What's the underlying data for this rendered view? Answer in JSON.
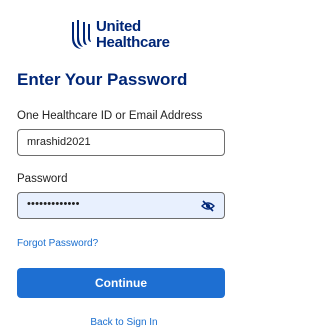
{
  "brand": {
    "line1": "United",
    "line2": "Healthcare",
    "logo_icon": "uhc-logo-icon",
    "color": "#002677"
  },
  "page_title": "Enter Your Password",
  "username_field": {
    "label": "One Healthcare ID or Email Address",
    "value": "mrashid2021"
  },
  "password_field": {
    "label": "Password",
    "masked_value": "•••••••••••••",
    "toggle_icon": "eye-slash-icon"
  },
  "forgot_password_link": "Forgot Password?",
  "continue_button": "Continue",
  "back_link": "Back to Sign In",
  "colors": {
    "primary_button": "#1e6fd2",
    "link": "#196ecf",
    "autofill_background": "#e8f0fe"
  }
}
